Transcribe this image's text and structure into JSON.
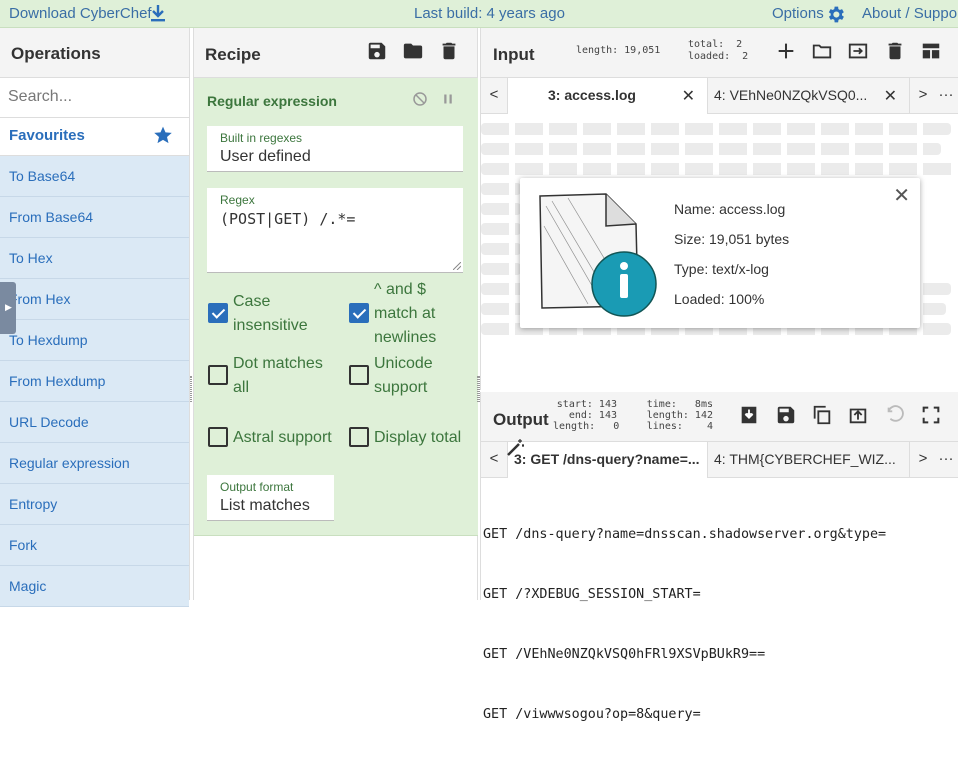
{
  "banner": {
    "download": "Download CyberChef",
    "last_build": "Last build: 4 years ago",
    "options": "Options",
    "about": "About / Support"
  },
  "operations": {
    "title": "Operations",
    "search_placeholder": "Search...",
    "favourites": "Favourites",
    "items": [
      "To Base64",
      "From Base64",
      "To Hex",
      "From Hex",
      "To Hexdump",
      "From Hexdump",
      "URL Decode",
      "Regular expression",
      "Entropy",
      "Fork",
      "Magic"
    ]
  },
  "recipe": {
    "title": "Recipe",
    "op_name": "Regular expression",
    "builtin_label": "Built in regexes",
    "builtin_value": "User defined",
    "regex_label": "Regex",
    "regex_value": "(POST|GET) /.*=",
    "checkboxes": [
      {
        "label": "Case insensitive",
        "checked": true
      },
      {
        "label": "^ and $ match at newlines",
        "checked": true
      },
      {
        "label": "Dot matches all",
        "checked": false
      },
      {
        "label": "Unicode support",
        "checked": false
      },
      {
        "label": "Astral support",
        "checked": false
      },
      {
        "label": "Display total",
        "checked": false
      }
    ],
    "output_format_label": "Output format",
    "output_format_value": "List matches"
  },
  "input": {
    "title": "Input",
    "length": "length: 19,051",
    "total": "total:  2",
    "loaded": "loaded:  2",
    "tabs": [
      "3: access.log",
      "4: VEhNe0NZQkVSQ0..."
    ],
    "nav_prev": "<",
    "nav_next": ">",
    "more": "···"
  },
  "popup": {
    "name": "Name: access.log",
    "size": "Size: 19,051 bytes",
    "type": "Type: text/x-log",
    "loaded": "Loaded: 100%"
  },
  "output": {
    "title": "Output",
    "start": "start: 143",
    "end": "end: 143",
    "length": "length:   0",
    "time": "time:   8ms",
    "length2": "length: 142",
    "lines": "lines:    4",
    "tabs": [
      "3: GET /dns-query?name=...",
      "4: THM{CYBERCHEF_WIZ..."
    ],
    "lines_text": [
      "GET /dns-query?name=dnsscan.shadowserver.org&type=",
      "GET /?XDEBUG_SESSION_START=",
      "GET /VEhNe0NZQkVSQ0hFRl9XSVpBUkR9==",
      "GET /viwwwsogou?op=8&query="
    ]
  },
  "colors": {
    "banner_bg": "#dff0d8",
    "accent": "#2a6ebb",
    "op_item_bg": "#dbe9f5",
    "recipe_green": "#3c763d"
  }
}
